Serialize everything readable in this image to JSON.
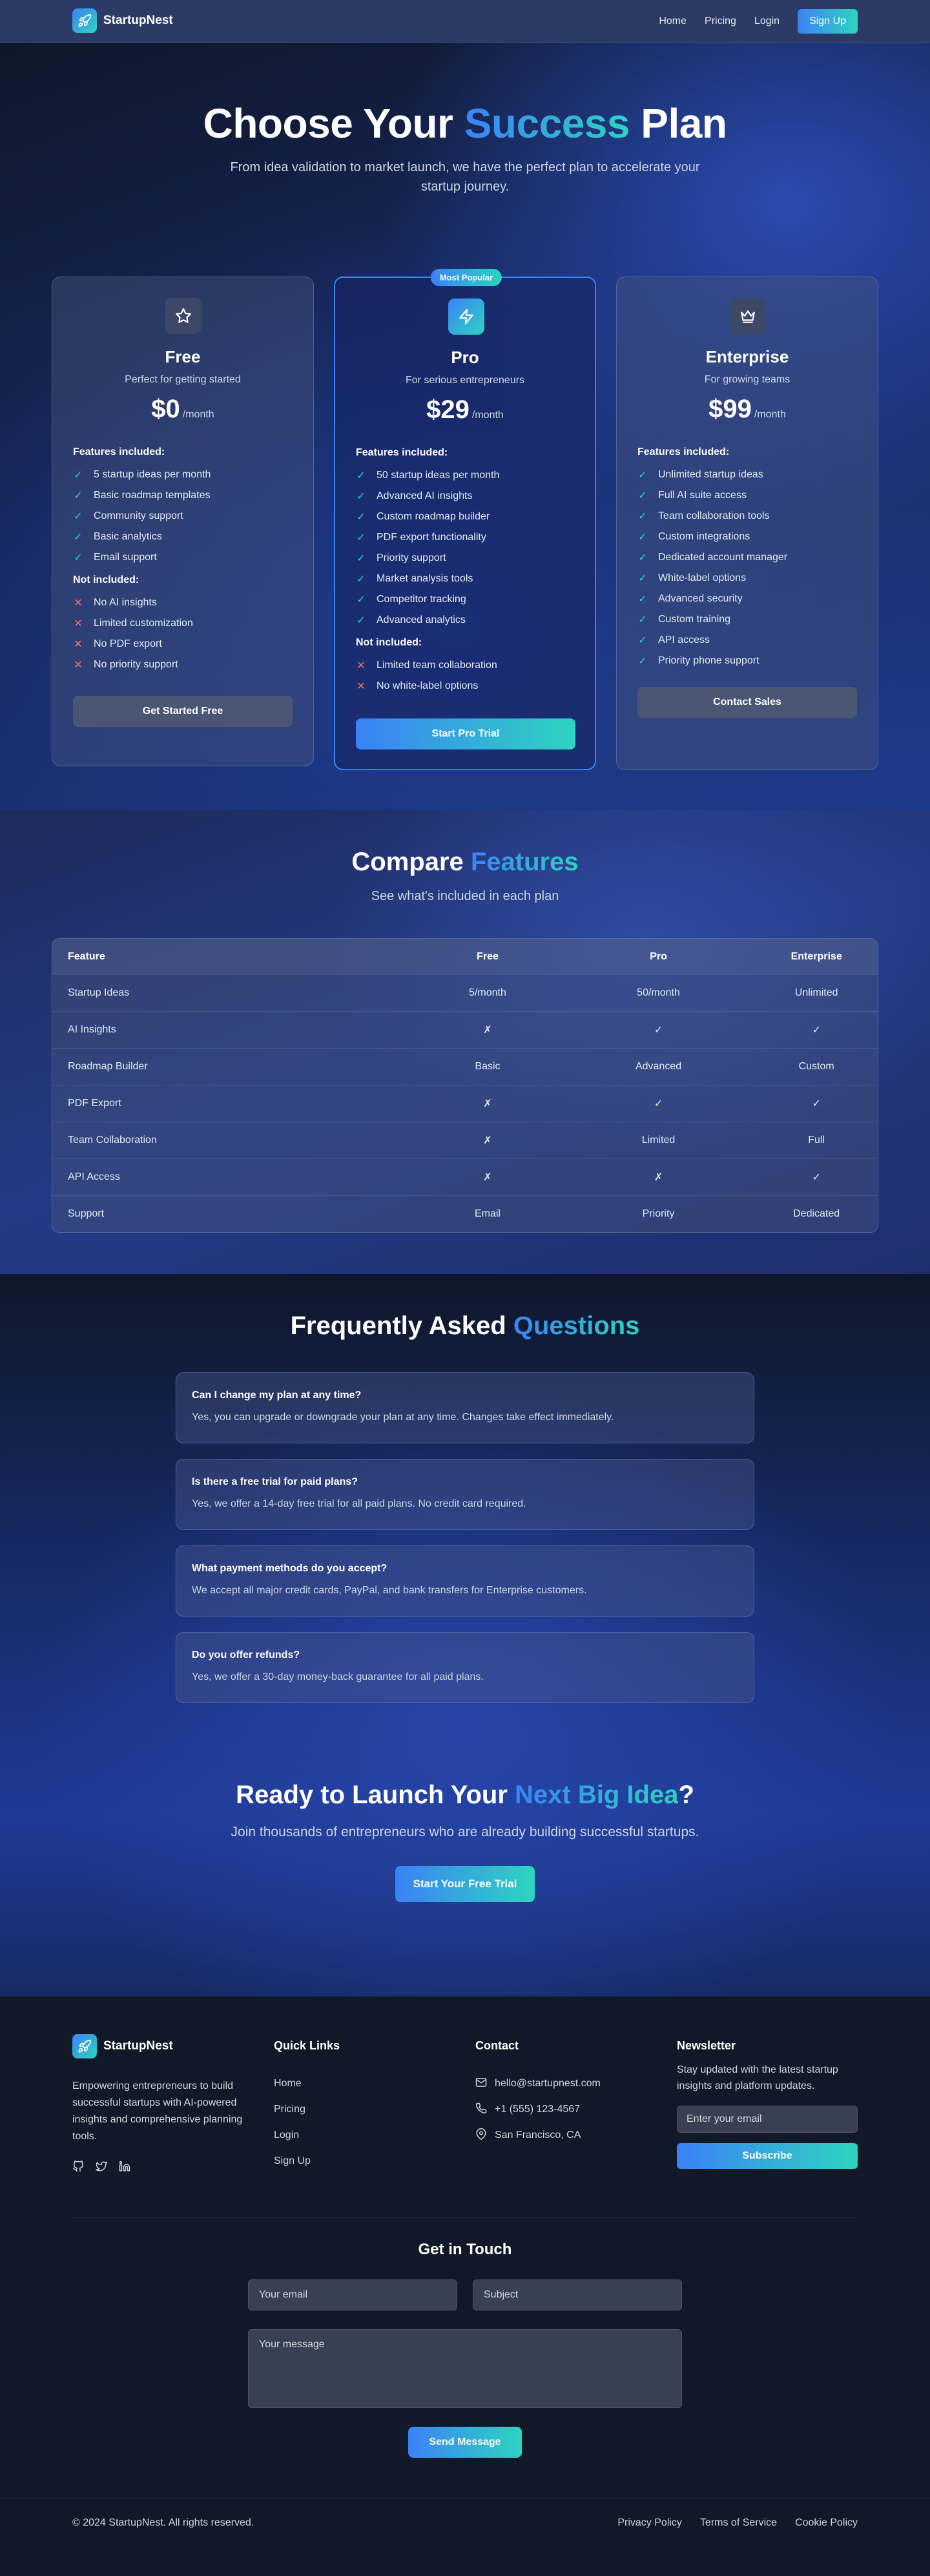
{
  "brand": {
    "name": "StartupNest"
  },
  "nav": {
    "links": [
      "Home",
      "Pricing",
      "Login"
    ],
    "signup": "Sign Up"
  },
  "hero": {
    "title_pre": "Choose Your ",
    "title_accent": "Success",
    "title_post": " Plan",
    "subtitle": "From idea validation to market launch, we have the perfect plan to accelerate your startup journey."
  },
  "plans": [
    {
      "icon": "star-icon",
      "name": "Free",
      "desc": "Perfect for getting started",
      "price": "$0",
      "period": "/month",
      "included_label": "Features included:",
      "included": [
        "5 startup ideas per month",
        "Basic roadmap templates",
        "Community support",
        "Basic analytics",
        "Email support"
      ],
      "excluded_label": "Not included:",
      "excluded": [
        "No AI insights",
        "Limited customization",
        "No PDF export",
        "No priority support"
      ],
      "cta": "Get Started Free"
    },
    {
      "icon": "lightning-icon",
      "badge": "Most Popular",
      "name": "Pro",
      "desc": "For serious entrepreneurs",
      "price": "$29",
      "period": "/month",
      "included_label": "Features included:",
      "included": [
        "50 startup ideas per month",
        "Advanced AI insights",
        "Custom roadmap builder",
        "PDF export functionality",
        "Priority support",
        "Market analysis tools",
        "Competitor tracking",
        "Advanced analytics"
      ],
      "excluded_label": "Not included:",
      "excluded": [
        "Limited team collaboration",
        "No white-label options"
      ],
      "cta": "Start Pro Trial"
    },
    {
      "icon": "crown-icon",
      "name": "Enterprise",
      "desc": "For growing teams",
      "price": "$99",
      "period": "/month",
      "included_label": "Features included:",
      "included": [
        "Unlimited startup ideas",
        "Full AI suite access",
        "Team collaboration tools",
        "Custom integrations",
        "Dedicated account manager",
        "White-label options",
        "Advanced security",
        "Custom training",
        "API access",
        "Priority phone support"
      ],
      "cta": "Contact Sales"
    }
  ],
  "compare": {
    "title_pre": "Compare ",
    "title_accent": "Features",
    "subtitle": "See what's included in each plan",
    "headers": [
      "Feature",
      "Free",
      "Pro",
      "Enterprise"
    ],
    "rows": [
      [
        "Startup Ideas",
        "5/month",
        "50/month",
        "Unlimited"
      ],
      [
        "AI Insights",
        "✗",
        "✓",
        "✓"
      ],
      [
        "Roadmap Builder",
        "Basic",
        "Advanced",
        "Custom"
      ],
      [
        "PDF Export",
        "✗",
        "✓",
        "✓"
      ],
      [
        "Team Collaboration",
        "✗",
        "Limited",
        "Full"
      ],
      [
        "API Access",
        "✗",
        "✗",
        "✓"
      ],
      [
        "Support",
        "Email",
        "Priority",
        "Dedicated"
      ]
    ]
  },
  "faq": {
    "title_pre": "Frequently Asked ",
    "title_accent": "Questions",
    "items": [
      {
        "q": "Can I change my plan at any time?",
        "a": "Yes, you can upgrade or downgrade your plan at any time. Changes take effect immediately."
      },
      {
        "q": "Is there a free trial for paid plans?",
        "a": "Yes, we offer a 14-day free trial for all paid plans. No credit card required."
      },
      {
        "q": "What payment methods do you accept?",
        "a": "We accept all major credit cards, PayPal, and bank transfers for Enterprise customers."
      },
      {
        "q": "Do you offer refunds?",
        "a": "Yes, we offer a 30-day money-back guarantee for all paid plans."
      }
    ]
  },
  "cta": {
    "title_pre": "Ready to Launch Your ",
    "title_accent": "Next Big Idea",
    "title_post": "?",
    "subtitle": "Join thousands of entrepreneurs who are already building successful startups.",
    "button": "Start Your Free Trial"
  },
  "footer": {
    "about": "Empowering entrepreneurs to build successful startups with AI-powered insights and comprehensive planning tools.",
    "social": [
      "github-icon",
      "twitter-icon",
      "linkedin-icon"
    ],
    "quick_links_title": "Quick Links",
    "quick_links": [
      "Home",
      "Pricing",
      "Login",
      "Sign Up"
    ],
    "contact_title": "Contact",
    "contact": {
      "email": "hello@startupnest.com",
      "phone": "+1 (555) 123-4567",
      "location": "San Francisco, CA"
    },
    "newsletter_title": "Newsletter",
    "newsletter_text": "Stay updated with the latest startup insights and platform updates.",
    "newsletter_placeholder": "Enter your email",
    "newsletter_button": "Subscribe",
    "git_title": "Get in Touch",
    "git_email_placeholder": "Your email",
    "git_subject_placeholder": "Subject",
    "git_message_placeholder": "Your message",
    "git_button": "Send Message",
    "copyright": "© 2024 StartupNest. All rights reserved.",
    "legal": [
      "Privacy Policy",
      "Terms of Service",
      "Cookie Policy"
    ]
  },
  "colors": {
    "accent_blue": "#3b82f6",
    "accent_teal": "#2dd4bf",
    "check": "#2dd4bf",
    "cross": "#f87171"
  }
}
